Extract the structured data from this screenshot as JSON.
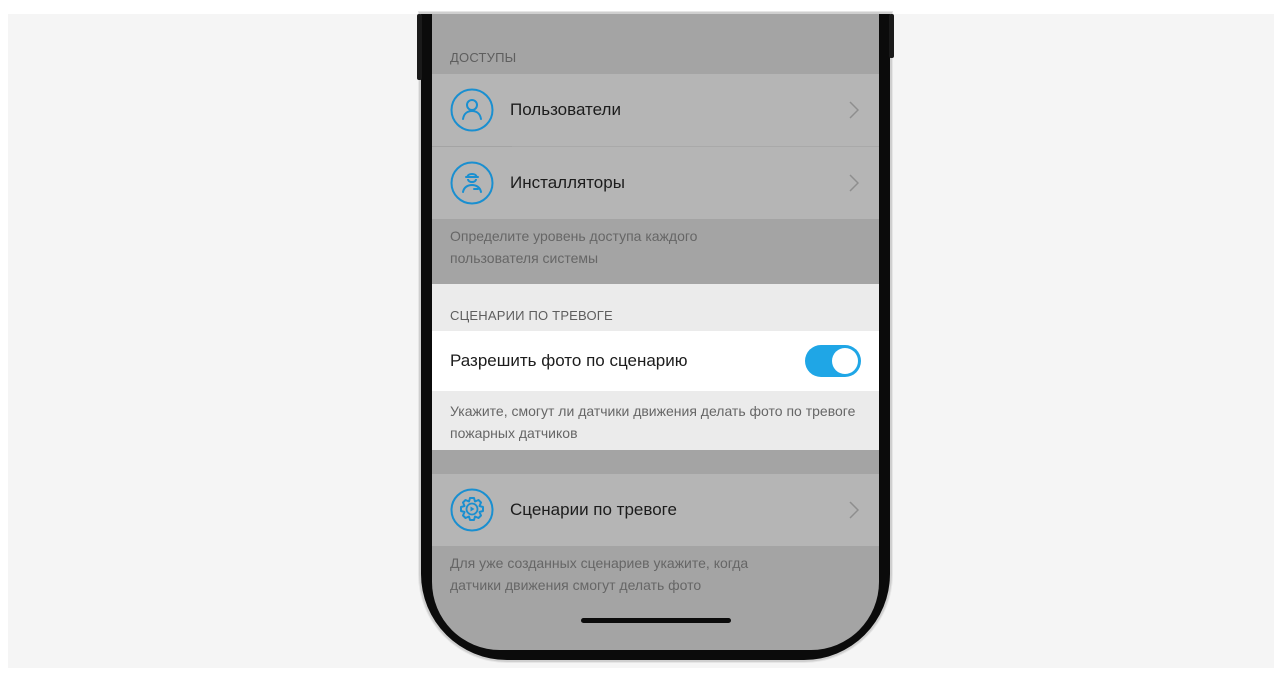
{
  "access": {
    "header": "ДОСТУПЫ",
    "items": [
      {
        "label": "Пользователи",
        "icon": "user-icon"
      },
      {
        "label": "Инсталляторы",
        "icon": "installer-icon"
      }
    ],
    "note": "Определите уровень доступа каждого пользователя системы"
  },
  "alarm": {
    "header": "СЦЕНАРИИ ПО ТРЕВОГЕ",
    "toggle_label": "Разрешить фото по сценарию",
    "toggle_on": true,
    "toggle_note": "Укажите, смогут ли датчики движения делать фото по тревоге пожарных датчиков",
    "nav_label": "Сценарии по тревоге",
    "nav_icon": "scenario-gear-play-icon",
    "nav_note": "Для уже созданных сценариев укажите, когда датчики движения смогут делать фото"
  },
  "colors": {
    "accent": "#1fa6e6",
    "dimmed_background": "#a4a4a4",
    "highlight_background": "#ebebeb"
  }
}
